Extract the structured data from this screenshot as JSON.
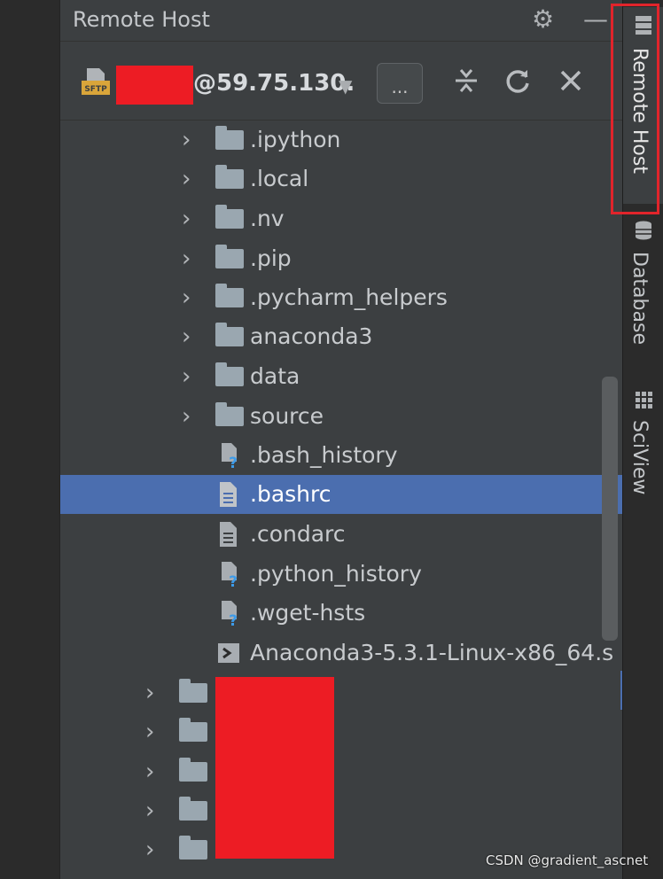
{
  "panel": {
    "title": "Remote Host"
  },
  "header_icons": {
    "settings": "gear-icon",
    "minimize": "minimize-icon"
  },
  "connection": {
    "protocol": "SFTP",
    "host_suffix": "@59.75.130.",
    "more_label": "..."
  },
  "tree": {
    "items": [
      {
        "label": ".ipython",
        "type": "folder"
      },
      {
        "label": ".local",
        "type": "folder"
      },
      {
        "label": ".nv",
        "type": "folder"
      },
      {
        "label": ".pip",
        "type": "folder"
      },
      {
        "label": ".pycharm_helpers",
        "type": "folder"
      },
      {
        "label": "anaconda3",
        "type": "folder"
      },
      {
        "label": "data",
        "type": "folder"
      },
      {
        "label": "source",
        "type": "folder"
      },
      {
        "label": ".bash_history",
        "type": "unknown-file"
      },
      {
        "label": ".bashrc",
        "type": "text-file",
        "selected": true
      },
      {
        "label": ".condarc",
        "type": "text-file"
      },
      {
        "label": ".python_history",
        "type": "unknown-file"
      },
      {
        "label": ".wget-hsts",
        "type": "unknown-file"
      },
      {
        "label": "Anaconda3-5.3.1-Linux-x86_64.s",
        "type": "shell-file"
      }
    ]
  },
  "side_tabs": [
    {
      "label": "Remote Host",
      "active": true
    },
    {
      "label": "Database",
      "active": false
    },
    {
      "label": "SciView",
      "active": false
    }
  ],
  "watermark": "CSDN @gradient_ascnet",
  "colors": {
    "selection": "#4b6eaf",
    "redaction": "#ed1c24",
    "highlight": "#e1242b"
  }
}
